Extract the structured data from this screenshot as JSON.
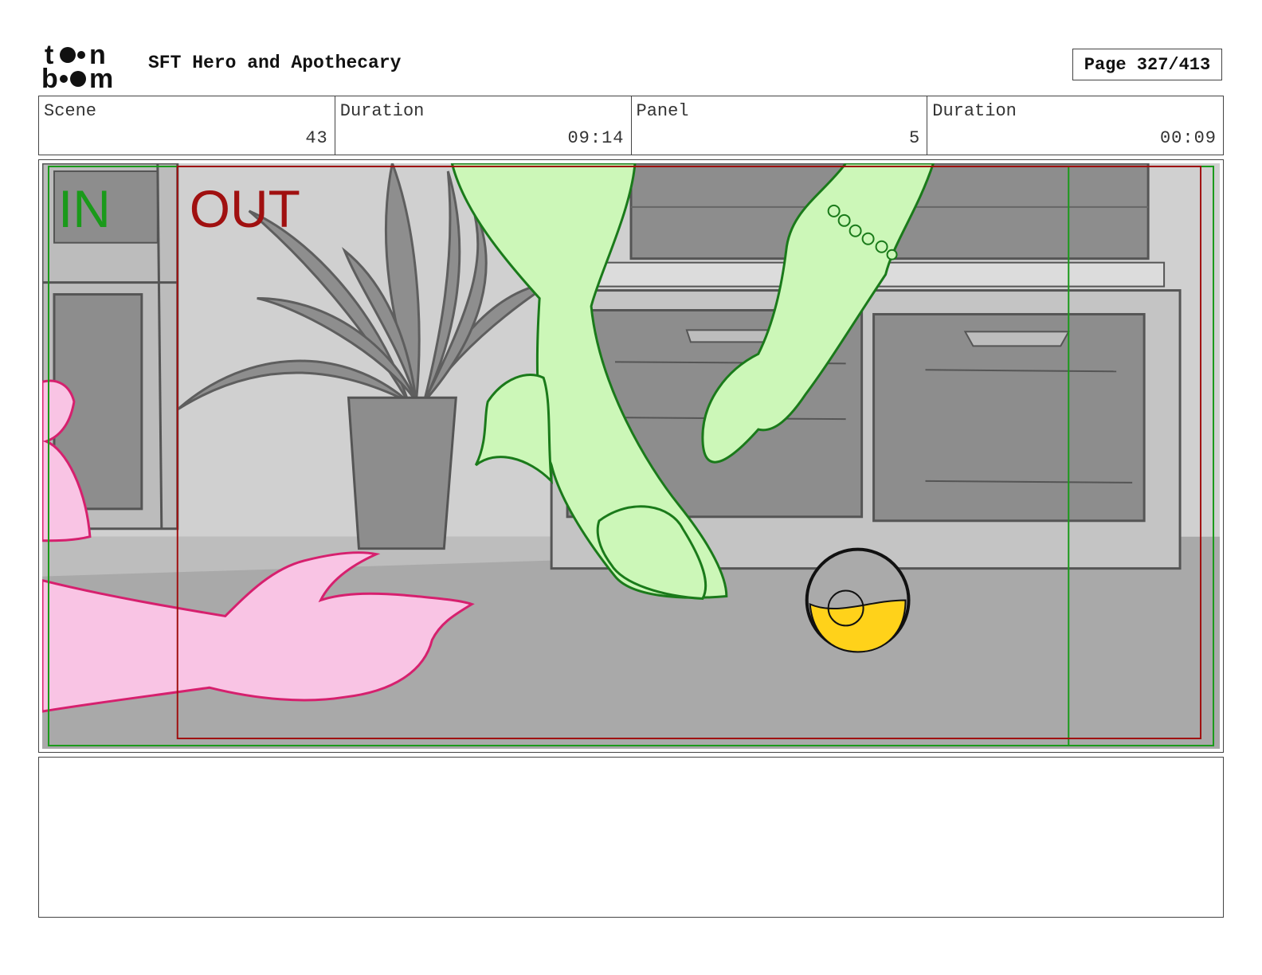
{
  "header": {
    "doc_title": "SFT Hero and Apothecary",
    "page_label": "Page 327/413"
  },
  "info": {
    "scene_label": "Scene",
    "scene_value": "43",
    "scene_duration_label": "Duration",
    "scene_duration_value": "09:14",
    "panel_label": "Panel",
    "panel_value": "5",
    "panel_duration_label": "Duration",
    "panel_duration_value": "00:09"
  },
  "panel": {
    "in_label": "IN",
    "out_label": "OUT",
    "colors": {
      "in_marker": "#1a9a1a",
      "out_marker": "#a01010",
      "green_character": "#ccf7b8",
      "green_outline": "#1a7a1a",
      "pink_character": "#f9c4e4",
      "pink_outline": "#d6206e",
      "liquid": "#ffd21a"
    }
  },
  "notes": {}
}
